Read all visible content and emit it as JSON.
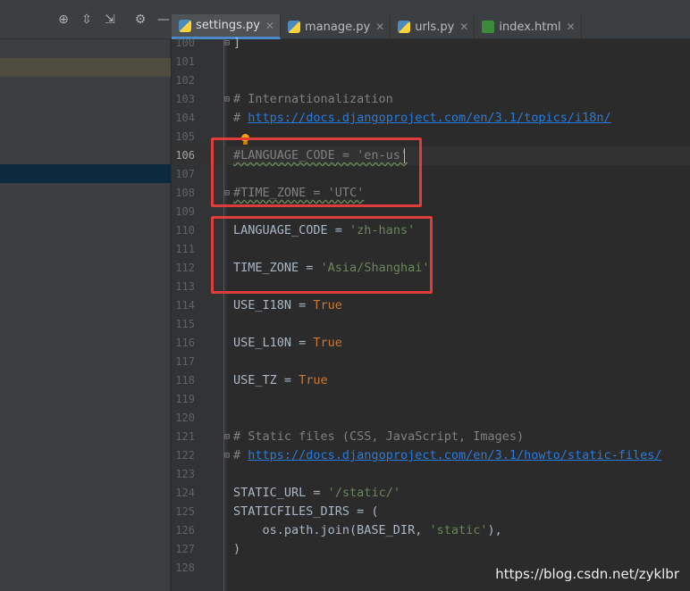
{
  "toolbar": {
    "icons": [
      "crosshair-icon",
      "expand-all-icon",
      "collapse-all-icon",
      "gear-icon",
      "minimize-icon"
    ]
  },
  "tabs": [
    {
      "label": "settings.py",
      "active": true,
      "icon": "python-file-icon"
    },
    {
      "label": "manage.py",
      "active": false,
      "icon": "python-file-icon"
    },
    {
      "label": "urls.py",
      "active": false,
      "icon": "python-file-icon"
    },
    {
      "label": "index.html",
      "active": false,
      "icon": "html-file-icon"
    }
  ],
  "editor": {
    "current_line": "106",
    "line_numbers": [
      "100",
      "101",
      "102",
      "103",
      "104",
      "105",
      "106",
      "107",
      "108",
      "109",
      "110",
      "111",
      "112",
      "113",
      "114",
      "115",
      "116",
      "117",
      "118",
      "119",
      "120",
      "121",
      "122",
      "123",
      "124",
      "125",
      "126",
      "127",
      "128"
    ],
    "lines": {
      "l100": "]",
      "l103": "# Internationalization",
      "l104_prefix": "# ",
      "l104_url": "https://docs.djangoproject.com/en/3.1/topics/i18n/",
      "l106": "#LANGUAGE_CODE = 'en-us'",
      "l108": "#TIME_ZONE = 'UTC'",
      "l110_key": "LANGUAGE_CODE = ",
      "l110_val": "'zh-hans'",
      "l112_key": "TIME_ZONE = ",
      "l112_val": "'Asia/Shanghai'",
      "l114_key": "USE_I18N = ",
      "l114_val": "True",
      "l116_key": "USE_L10N = ",
      "l116_val": "True",
      "l118_key": "USE_TZ = ",
      "l118_val": "True",
      "l121": "# Static files (CSS, JavaScript, Images)",
      "l122_prefix": "# ",
      "l122_url": "https://docs.djangoproject.com/en/3.1/howto/static-files/",
      "l124_key": "STATIC_URL = ",
      "l124_val": "'/static/'",
      "l125": "STATICFILES_DIRS = (",
      "l126_a": "    os.path.join(BASE_DIR, ",
      "l126_b": "'static'",
      "l126_c": "),",
      "l127": ")"
    }
  },
  "watermark": "https://blog.csdn.net/zyklbr",
  "colors": {
    "highlight_box": "#e03c3c",
    "string": "#6a8759",
    "keyword": "#cc7832",
    "comment": "#808080",
    "link": "#287bde"
  }
}
